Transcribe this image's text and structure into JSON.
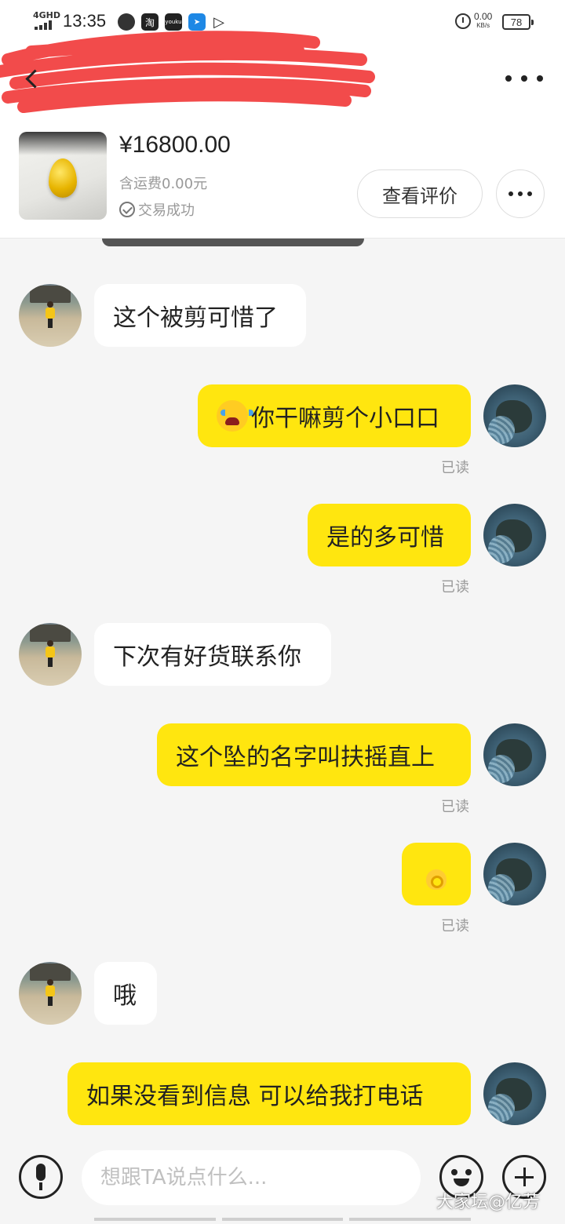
{
  "status_bar": {
    "network": "4GHD",
    "time": "13:35",
    "apps": [
      {
        "icon": "taobao-icon",
        "label": "淘",
        "color": "#222"
      },
      {
        "icon": "youku-icon",
        "label": "youku",
        "color": "#222"
      },
      {
        "icon": "paper-plane-icon",
        "label": "",
        "color": "#1e88e5"
      }
    ],
    "speed_value": "0.00",
    "speed_unit": "KB/s",
    "battery": "78"
  },
  "product": {
    "price": "¥16800.00",
    "shipping": "含运费0.00元",
    "status": "交易成功",
    "review_button": "查看评价"
  },
  "messages": [
    {
      "side": "left",
      "text": "这个被剪可惜了"
    },
    {
      "side": "right",
      "text": "你干嘛剪个小口口",
      "read": "已读"
    },
    {
      "side": "right",
      "text": "是的多可惜",
      "read": "已读"
    },
    {
      "side": "left",
      "text": "下次有好货联系你"
    },
    {
      "side": "right",
      "text": "这个坠的名字叫扶摇直上",
      "read": "已读"
    },
    {
      "side": "right",
      "text": "",
      "read": "已读"
    },
    {
      "side": "left",
      "text": "哦"
    },
    {
      "side": "right",
      "text": "如果没看到信息  可以给我打电话"
    }
  ],
  "input": {
    "placeholder": "想跟TA说点什么..."
  },
  "watermark": "大家坛@亿芳"
}
